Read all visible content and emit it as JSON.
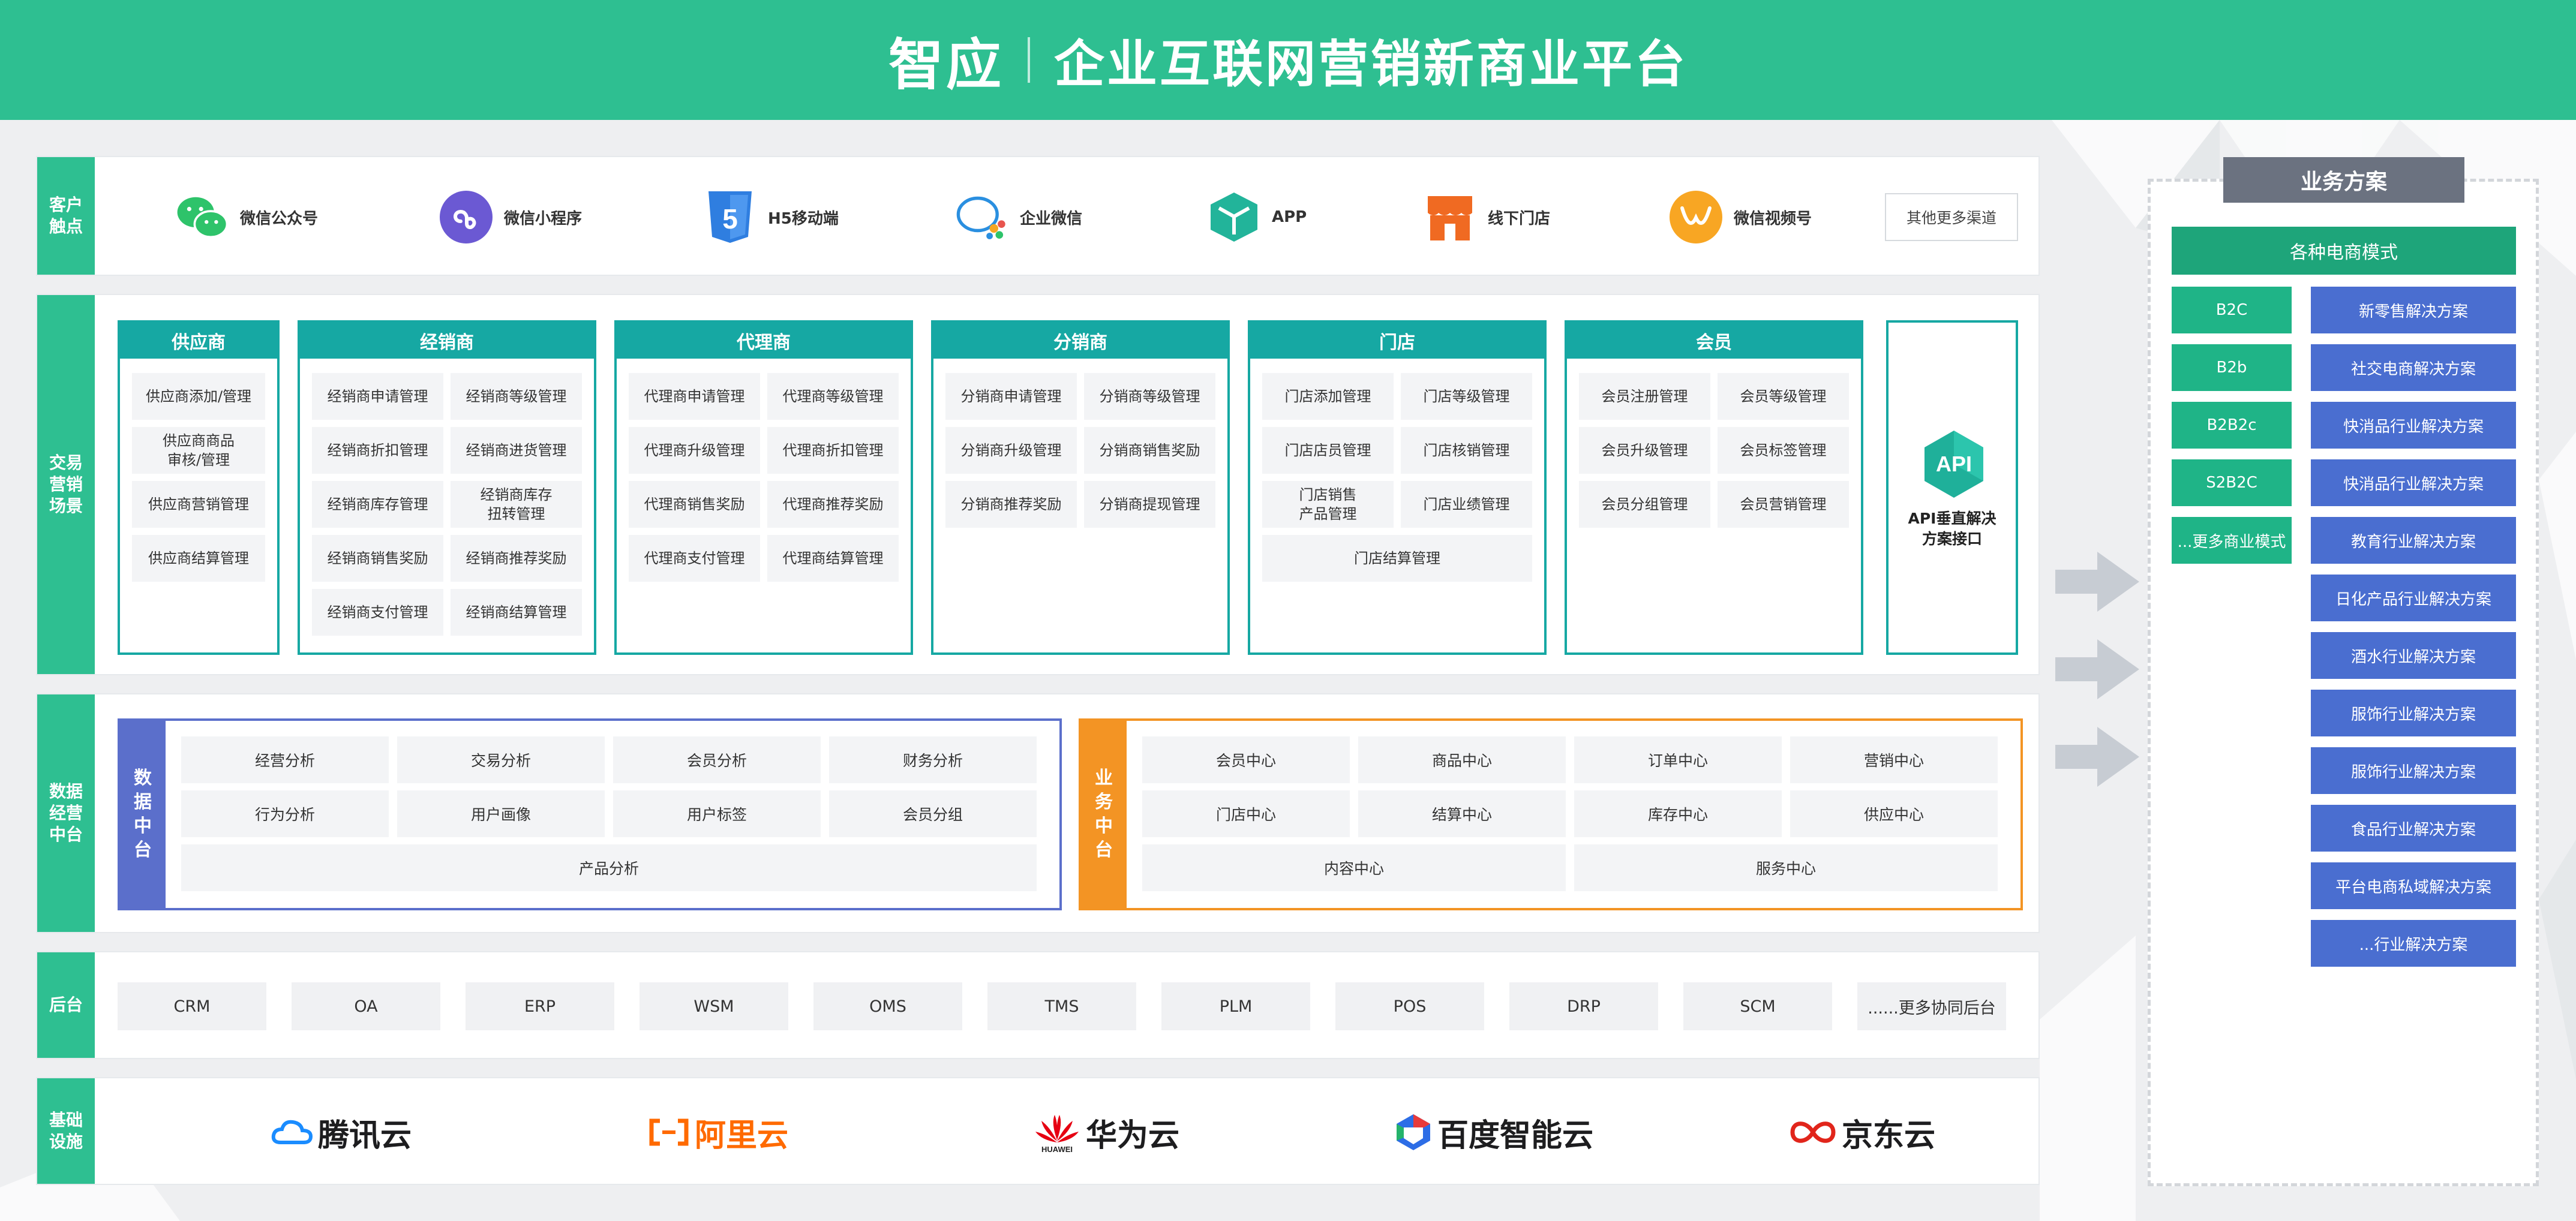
{
  "header": {
    "logo": "智应",
    "title": "企业互联网营销新商业平台"
  },
  "rows": {
    "touch": "客户触点",
    "trade": "交易营销场景",
    "data": "数据经营中台",
    "backend": "后台",
    "infra": "基础设施"
  },
  "channels": [
    {
      "label": "微信公众号",
      "icon": "wechat-icon"
    },
    {
      "label": "微信小程序",
      "icon": "miniprogram-icon"
    },
    {
      "label": "H5移动端",
      "icon": "html5-icon"
    },
    {
      "label": "企业微信",
      "icon": "wecom-icon"
    },
    {
      "label": "APP",
      "icon": "app-cube-icon"
    },
    {
      "label": "线下门店",
      "icon": "store-icon"
    },
    {
      "label": "微信视频号",
      "icon": "video-channel-icon"
    }
  ],
  "channels_more": "其他更多渠道",
  "scenes": [
    {
      "title": "供应商",
      "items": [
        "供应商添加/管理",
        "供应商商品\n审核/管理",
        "供应商营销管理",
        "供应商结算管理"
      ]
    },
    {
      "title": "经销商",
      "items": [
        "经销商申请管理",
        "经销商等级管理",
        "经销商折扣管理",
        "经销商进货管理",
        "经销商库存管理",
        "经销商库存\n扭转管理",
        "经销商销售奖励",
        "经销商推荐奖励",
        "经销商支付管理",
        "经销商结算管理"
      ]
    },
    {
      "title": "代理商",
      "items": [
        "代理商申请管理",
        "代理商等级管理",
        "代理商升级管理",
        "代理商折扣管理",
        "代理商销售奖励",
        "代理商推荐奖励",
        "代理商支付管理",
        "代理商结算管理"
      ]
    },
    {
      "title": "分销商",
      "items": [
        "分销商申请管理",
        "分销商等级管理",
        "分销商升级管理",
        "分销商销售奖励",
        "分销商推荐奖励",
        "分销商提现管理"
      ]
    },
    {
      "title": "门店",
      "items": [
        "门店添加管理",
        "门店等级管理",
        "门店店员管理",
        "门店核销管理",
        "门店销售\n产品管理",
        "门店业绩管理",
        "门店结算管理"
      ]
    },
    {
      "title": "会员",
      "items": [
        "会员注册管理",
        "会员等级管理",
        "会员升级管理",
        "会员标签管理",
        "会员分组管理",
        "会员营销管理"
      ]
    }
  ],
  "api": {
    "badge": "API",
    "label": "API垂直解决\n方案接口"
  },
  "data_center": {
    "title": "数据中台",
    "items": [
      "经营分析",
      "交易分析",
      "会员分析",
      "财务分析",
      "行为分析",
      "用户画像",
      "用户标签",
      "会员分组",
      "产品分析"
    ]
  },
  "biz_center": {
    "title": "业务中台",
    "items": [
      "会员中心",
      "商品中心",
      "订单中心",
      "营销中心",
      "门店中心",
      "结算中心",
      "库存中心",
      "供应中心",
      "内容中心",
      "服务中心"
    ]
  },
  "backend_systems": [
    "CRM",
    "OA",
    "ERP",
    "WSM",
    "OMS",
    "TMS",
    "PLM",
    "POS",
    "DRP",
    "SCM",
    "......更多协同后台"
  ],
  "clouds": [
    {
      "name": "腾讯云",
      "color": "#1d1d1f",
      "icon": "tencent-cloud-icon"
    },
    {
      "name": "阿里云",
      "color": "#ff6a00",
      "icon": "aliyun-icon"
    },
    {
      "name": "华为云",
      "color": "#1d1d1f",
      "icon": "huawei-icon",
      "sub": "HUAWEI"
    },
    {
      "name": "百度智能云",
      "color": "#1d1d1f",
      "icon": "baidu-cloud-icon"
    },
    {
      "name": "京东云",
      "color": "#1d1d1f",
      "icon": "jd-cloud-icon"
    }
  ],
  "solutions_panel": {
    "title": "业务方案",
    "header": "各种电商模式",
    "modes": [
      "B2C",
      "B2b",
      "B2B2c",
      "S2B2C",
      "...更多商业模式"
    ],
    "solutions": [
      "新零售解决方案",
      "社交电商解决方案",
      "快消品行业解决方案",
      "快消品行业解决方案",
      "教育行业解决方案",
      "日化产品行业解决方案",
      "酒水行业解决方案",
      "服饰行业解决方案",
      "服饰行业解决方案",
      "食品行业解决方案",
      "平台电商私域解决方案",
      "...行业解决方案"
    ]
  },
  "colors": {
    "brand_green": "#2ebf91",
    "teal": "#16a8a3",
    "data_blue": "#5b6fcb",
    "biz_orange": "#f39424",
    "solution_blue": "#4a6ed0",
    "mode_green": "#1fb487"
  }
}
